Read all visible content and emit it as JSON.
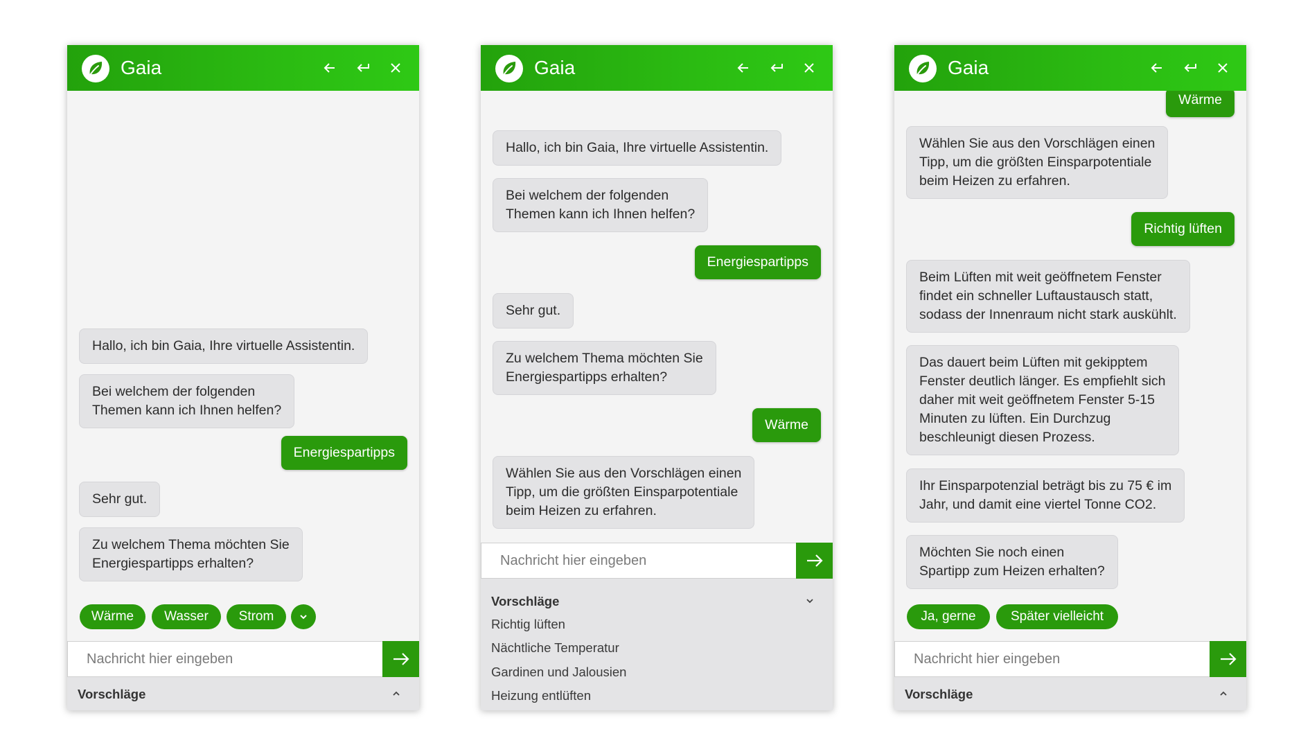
{
  "brand": {
    "name": "Gaia",
    "color": "#2a9a0c"
  },
  "icons": [
    "leaf-logo-icon",
    "arrow-left-icon",
    "undo-icon",
    "close-icon",
    "chevron-down-icon",
    "chevron-up-icon",
    "arrow-right-icon"
  ],
  "input": {
    "placeholder": "Nachricht hier eingeben"
  },
  "suggestions": {
    "label": "Vorschläge",
    "items": [
      "Richtig lüften",
      "Nächtliche Temperatur",
      "Gardinen und Jalousien",
      "Heizung entlüften"
    ]
  },
  "panel1": {
    "messages": [
      {
        "from": "bot",
        "lines": [
          "Hallo, ich bin Gaia, Ihre virtuelle Assistentin."
        ]
      },
      {
        "from": "bot",
        "lines": [
          "Bei welchem der folgenden",
          "Themen kann ich Ihnen helfen?"
        ]
      },
      {
        "from": "user",
        "lines": [
          "Energiespartipps"
        ]
      },
      {
        "from": "bot",
        "lines": [
          "Sehr gut."
        ]
      },
      {
        "from": "bot",
        "lines": [
          "Zu welchem Thema möchten Sie",
          "Energiespartipps erhalten?"
        ]
      }
    ],
    "quick_replies": [
      "Wärme",
      "Wasser",
      "Strom"
    ]
  },
  "panel2": {
    "messages": [
      {
        "from": "bot",
        "lines": [
          "Hallo, ich bin Gaia, Ihre virtuelle Assistentin."
        ]
      },
      {
        "from": "bot",
        "lines": [
          "Bei welchem der folgenden",
          "Themen kann ich Ihnen helfen?"
        ]
      },
      {
        "from": "user",
        "lines": [
          "Energiespartipps"
        ]
      },
      {
        "from": "bot",
        "lines": [
          "Sehr gut."
        ]
      },
      {
        "from": "bot",
        "lines": [
          "Zu welchem Thema möchten Sie",
          "Energiespartipps erhalten?"
        ]
      },
      {
        "from": "user",
        "lines": [
          "Wärme"
        ]
      },
      {
        "from": "bot",
        "lines": [
          "Wählen Sie aus den Vorschlägen einen",
          "Tipp, um die größten Einsparpotentiale",
          "beim Heizen zu erfahren."
        ]
      }
    ]
  },
  "panel3": {
    "messages": [
      {
        "from": "user",
        "lines": [
          "Wärme"
        ]
      },
      {
        "from": "bot",
        "lines": [
          "Wählen Sie aus den Vorschlägen einen",
          "Tipp, um die größten Einsparpotentiale",
          "beim Heizen zu erfahren."
        ]
      },
      {
        "from": "user",
        "lines": [
          "Richtig lüften"
        ]
      },
      {
        "from": "bot",
        "lines": [
          "Beim Lüften mit weit geöffnetem Fenster",
          "findet ein schneller Luftaustausch statt,",
          "sodass der Innenraum nicht stark auskühlt."
        ]
      },
      {
        "from": "bot",
        "lines": [
          "Das dauert beim Lüften mit gekipptem",
          "Fenster deutlich länger. Es empfiehlt sich",
          "daher mit weit geöffnetem Fenster 5-15",
          "Minuten zu lüften. Ein Durchzug",
          "beschleunigt diesen Prozess."
        ]
      },
      {
        "from": "bot",
        "lines": [
          "Ihr Einsparpotenzial beträgt bis zu 75 € im",
          "Jahr, und damit eine viertel Tonne CO2."
        ]
      },
      {
        "from": "bot",
        "lines": [
          "Möchten Sie noch einen",
          "Spartipp zum Heizen erhalten?"
        ]
      }
    ],
    "quick_replies": [
      "Ja, gerne",
      "Später vielleicht"
    ]
  }
}
